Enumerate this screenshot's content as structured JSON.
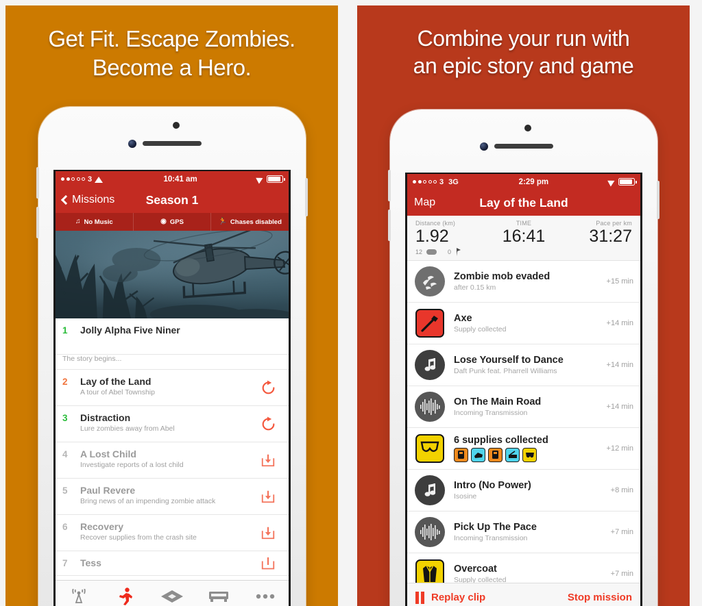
{
  "theme": {
    "left_bg": "#cc7a00",
    "right_bg": "#b8391c",
    "nav_red": "#c32b22",
    "strip_red": "#a8221a",
    "accent_red": "#ef3b26",
    "green": "#2bbd3b",
    "orange": "#f0743c"
  },
  "left_panel": {
    "headline_line1": "Get Fit. Escape Zombies.",
    "headline_line2": "Become a Hero.",
    "status_bar": {
      "carrier": "3",
      "wifi_icon": "wifi-icon",
      "time": "10:41 am",
      "location_icon": "location-arrow-icon",
      "battery_icon": "battery-icon"
    },
    "nav": {
      "back_label": "Missions",
      "title": "Season 1"
    },
    "settings_strip": [
      {
        "icon": "music-note-icon",
        "label": "No Music"
      },
      {
        "icon": "gps-target-icon",
        "label": "GPS"
      },
      {
        "icon": "running-man-icon",
        "label": "Chases disabled"
      }
    ],
    "hero_alt": "helicopter-over-dead-forest-artwork",
    "missions": [
      {
        "num": "1",
        "num_color": "green",
        "title": "Jolly Alpha Five Niner",
        "desc": "The story begins...",
        "action": "none",
        "dim": false
      },
      {
        "num": "2",
        "num_color": "orange",
        "title": "Lay of the Land",
        "desc": "A tour of Abel Township",
        "action": "replay",
        "dim": false
      },
      {
        "num": "3",
        "num_color": "green",
        "title": "Distraction",
        "desc": "Lure zombies away from Abel",
        "action": "replay",
        "dim": false
      },
      {
        "num": "4",
        "num_color": "gray",
        "title": "A Lost Child",
        "desc": "Investigate reports of a lost child",
        "action": "download",
        "dim": true
      },
      {
        "num": "5",
        "num_color": "gray",
        "title": "Paul Revere",
        "desc": "Bring news of an impending zombie attack",
        "action": "download",
        "dim": true
      },
      {
        "num": "6",
        "num_color": "gray",
        "title": "Recovery",
        "desc": "Recover supplies from the crash site",
        "action": "download",
        "dim": true
      },
      {
        "num": "7",
        "num_color": "gray",
        "title": "Tess",
        "desc": "",
        "action": "download",
        "dim": true
      }
    ],
    "tabbar": [
      {
        "icon": "radio-broadcast-icon",
        "active": false
      },
      {
        "icon": "running-man-icon",
        "active": true
      },
      {
        "icon": "supply-diamond-icon",
        "active": false
      },
      {
        "icon": "base-building-icon",
        "active": false
      },
      {
        "icon": "more-dots-icon",
        "active": false
      }
    ]
  },
  "right_panel": {
    "headline_line1": "Combine your run with",
    "headline_line2": "an epic story and game",
    "status_bar": {
      "carrier": "3",
      "network": "3G",
      "time": "2:29 pm",
      "location_icon": "location-arrow-icon",
      "battery_icon": "battery-icon"
    },
    "nav": {
      "back_label": "Map",
      "title": "Lay of the Land"
    },
    "stats": {
      "distance_label": "Distance (km)",
      "distance_value": "1.92",
      "time_label": "TIME",
      "time_value": "16:41",
      "pace_label": "Pace per km",
      "pace_value": "31:27",
      "sub_supplies": "12",
      "sub_supplies_icon": "supply-pill-icon",
      "sub_flags": "0",
      "sub_flags_icon": "flag-icon"
    },
    "events": [
      {
        "icon": "zombie-mob-icon",
        "icon_style": "circle-gray",
        "title": "Zombie mob evaded",
        "desc": "after 0.15 km",
        "time": "+15 min"
      },
      {
        "icon": "axe-icon",
        "icon_style": "square-red",
        "title": "Axe",
        "desc": "Supply collected",
        "time": "+14 min"
      },
      {
        "icon": "music-note-icon",
        "icon_style": "circle-dark",
        "title": "Lose Yourself to Dance",
        "desc": "Daft Punk feat. Pharrell Williams",
        "time": "+14 min"
      },
      {
        "icon": "waveform-icon",
        "icon_style": "circle-dark",
        "title": "On The Main Road",
        "desc": "Incoming Transmission",
        "time": "+14 min"
      },
      {
        "icon": "underwear-icon",
        "icon_style": "square-yellow",
        "title": "6 supplies collected",
        "desc": "",
        "time": "+12 min",
        "supplies": [
          "orange",
          "cyan",
          "orange",
          "cyan",
          "yellow"
        ]
      },
      {
        "icon": "music-note-icon",
        "icon_style": "circle-dark",
        "title": "Intro (No Power)",
        "desc": "Isosine",
        "time": "+8 min"
      },
      {
        "icon": "waveform-icon",
        "icon_style": "circle-dark",
        "title": "Pick Up The Pace",
        "desc": "Incoming Transmission",
        "time": "+7 min"
      },
      {
        "icon": "overcoat-icon",
        "icon_style": "square-yellow",
        "title": "Overcoat",
        "desc": "Supply collected",
        "time": "+7 min"
      }
    ],
    "footer": {
      "pause_icon": "pause-icon",
      "replay_label": "Replay clip",
      "stop_label": "Stop mission"
    }
  }
}
